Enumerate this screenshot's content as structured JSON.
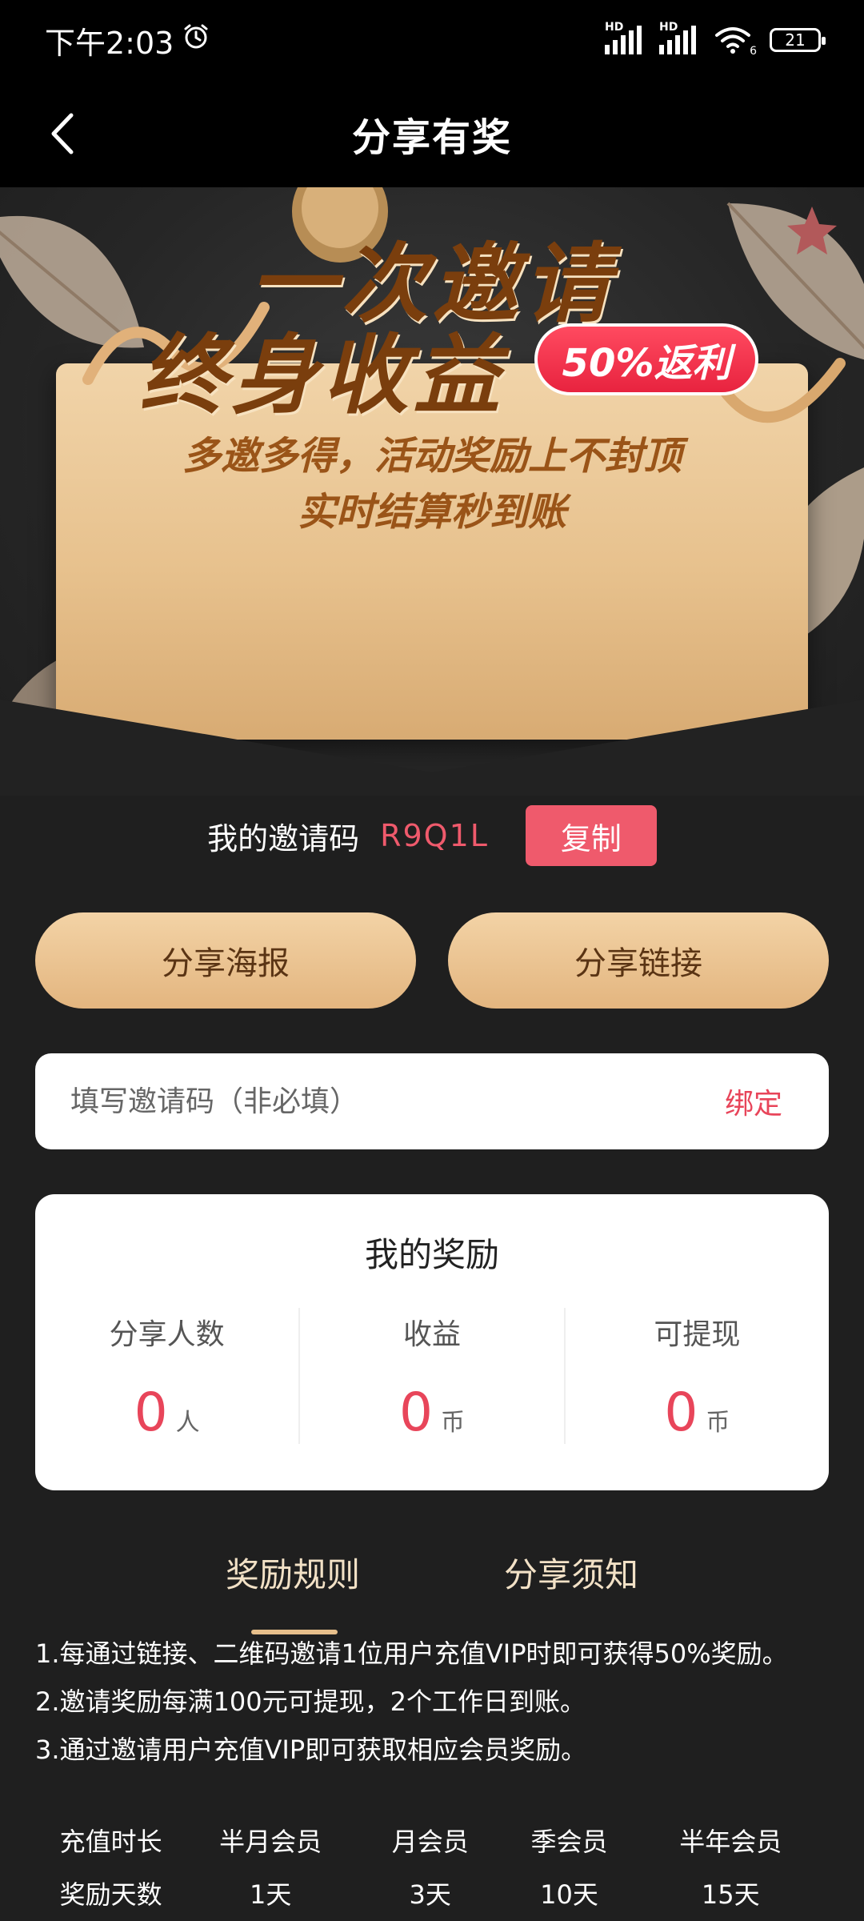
{
  "status_bar": {
    "time": "下午2:03",
    "network_1": "HD",
    "network_2": "HD",
    "wifi_badge": "6",
    "battery": "21"
  },
  "nav": {
    "title": "分享有奖"
  },
  "banner": {
    "line1": "一次邀请",
    "line2": "终身收益",
    "badge": "50%返利",
    "sub1": "多邀多得，活动奖励上不封顶",
    "sub2": "实时结算秒到账"
  },
  "invite": {
    "label": "我的邀请码",
    "code": "R9Q1L",
    "copy_label": "复制"
  },
  "share": {
    "poster_label": "分享海报",
    "link_label": "分享链接"
  },
  "invite_input": {
    "placeholder": "填写邀请码（非必填）",
    "value": "",
    "bind_label": "绑定"
  },
  "rewards": {
    "title": "我的奖励",
    "stats": [
      {
        "label": "分享人数",
        "value": "0",
        "unit": "人"
      },
      {
        "label": "收益",
        "value": "0",
        "unit": "币"
      },
      {
        "label": "可提现",
        "value": "0",
        "unit": "币"
      }
    ]
  },
  "tabs": [
    {
      "label": "奖励规则",
      "active": true
    },
    {
      "label": "分享须知",
      "active": false
    }
  ],
  "rules": [
    "1.每通过链接、二维码邀请1位用户充值VIP时即可获得50%奖励。",
    "2.邀请奖励每满100元可提现，2个工作日到账。",
    "3.通过邀请用户充值VIP即可获取相应会员奖励。"
  ],
  "reward_table": {
    "header": [
      "充值时长",
      "半月会员",
      "月会员",
      "季会员",
      "半年会员"
    ],
    "row": [
      "奖励天数",
      "1天",
      "3天",
      "10天",
      "15天"
    ]
  },
  "colors": {
    "accent_red": "#ef5a6c",
    "gold": "#e7bf8b",
    "background": "#1f1f1f"
  }
}
